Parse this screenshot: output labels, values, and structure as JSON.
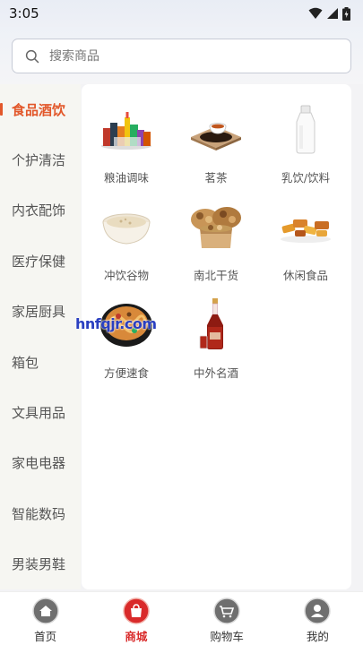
{
  "status_bar": {
    "time": "3:05"
  },
  "search": {
    "placeholder": "搜索商品"
  },
  "sidebar": {
    "items": [
      {
        "label": "食品酒饮",
        "active": true
      },
      {
        "label": "个护清洁"
      },
      {
        "label": "内衣配饰"
      },
      {
        "label": "医疗保健"
      },
      {
        "label": "家居厨具"
      },
      {
        "label": "箱包"
      },
      {
        "label": "文具用品"
      },
      {
        "label": "家电电器"
      },
      {
        "label": "智能数码"
      },
      {
        "label": "男装男鞋"
      }
    ]
  },
  "subcategories": [
    {
      "label": "粮油调味",
      "icon": "groceries-icon"
    },
    {
      "label": "茗茶",
      "icon": "tea-icon"
    },
    {
      "label": "乳饮/饮料",
      "icon": "milk-bottle-icon"
    },
    {
      "label": "冲饮谷物",
      "icon": "porridge-icon"
    },
    {
      "label": "南北干货",
      "icon": "nuts-icon"
    },
    {
      "label": "休闲食品",
      "icon": "snacks-icon"
    },
    {
      "label": "方便速食",
      "icon": "instant-noodle-icon"
    },
    {
      "label": "中外名酒",
      "icon": "wine-bottle-icon"
    }
  ],
  "watermark": "hnfqjr.com",
  "tabbar": {
    "items": [
      {
        "label": "首页"
      },
      {
        "label": "商城",
        "active": true
      },
      {
        "label": "购物车"
      },
      {
        "label": "我的"
      }
    ]
  },
  "colors": {
    "accent": "#e2572a",
    "tab_active": "#d92a2a"
  }
}
